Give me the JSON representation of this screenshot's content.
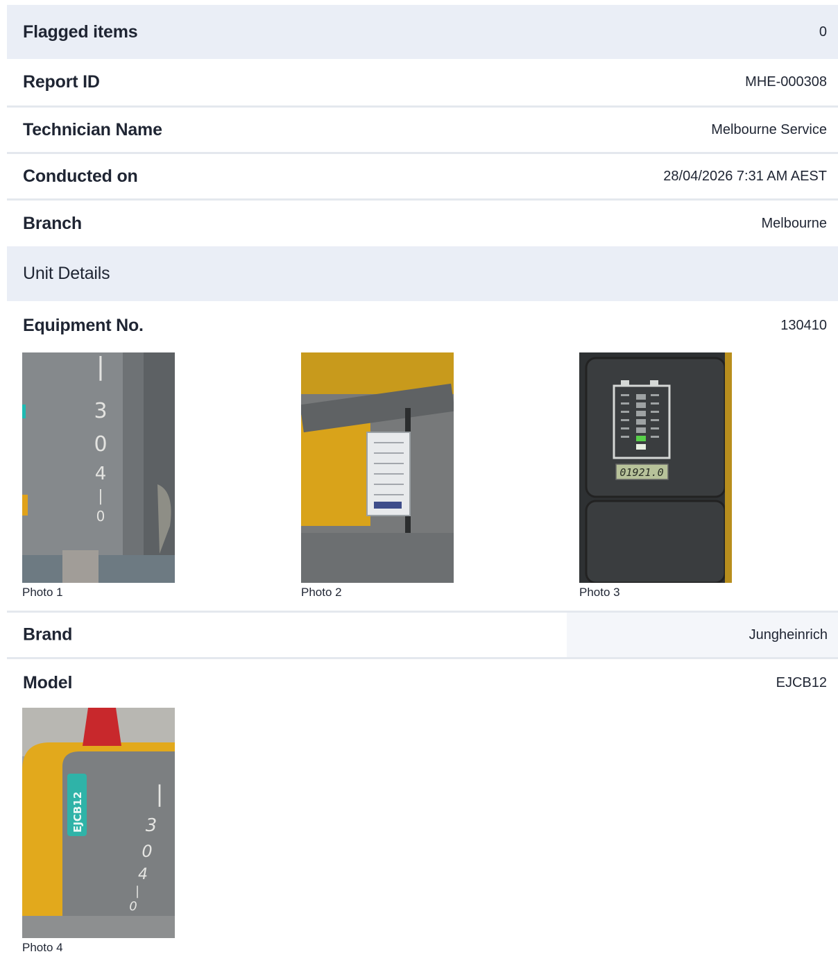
{
  "flagged": {
    "label": "Flagged items",
    "value": "0"
  },
  "report_id": {
    "label": "Report ID",
    "value": "MHE-000308"
  },
  "technician": {
    "label": "Technician Name",
    "value": "Melbourne Service"
  },
  "conducted": {
    "label": "Conducted on",
    "value": "28/04/2026 7:31 AM AEST"
  },
  "branch": {
    "label": "Branch",
    "value": "Melbourne"
  },
  "section": {
    "title": "Unit Details"
  },
  "equipment": {
    "label": "Equipment No.",
    "value": "130410",
    "photos": [
      {
        "caption": "Photo 1",
        "stencil": [
          "|",
          "3",
          "0",
          "4",
          "|",
          "0"
        ]
      },
      {
        "caption": "Photo 2"
      },
      {
        "caption": "Photo 3",
        "lcd": "01921.0"
      }
    ]
  },
  "brand": {
    "label": "Brand",
    "value": "Jungheinrich"
  },
  "model": {
    "label": "Model",
    "value": "EJCB12",
    "photos": [
      {
        "caption": "Photo 4",
        "tag": "EJCB12",
        "stencil": [
          "|",
          "3",
          "0",
          "4",
          "|",
          "0"
        ]
      }
    ]
  },
  "colors": {
    "header_bg": "#eaeef6",
    "divider": "#e4e8ee",
    "text": "#1f2533"
  }
}
